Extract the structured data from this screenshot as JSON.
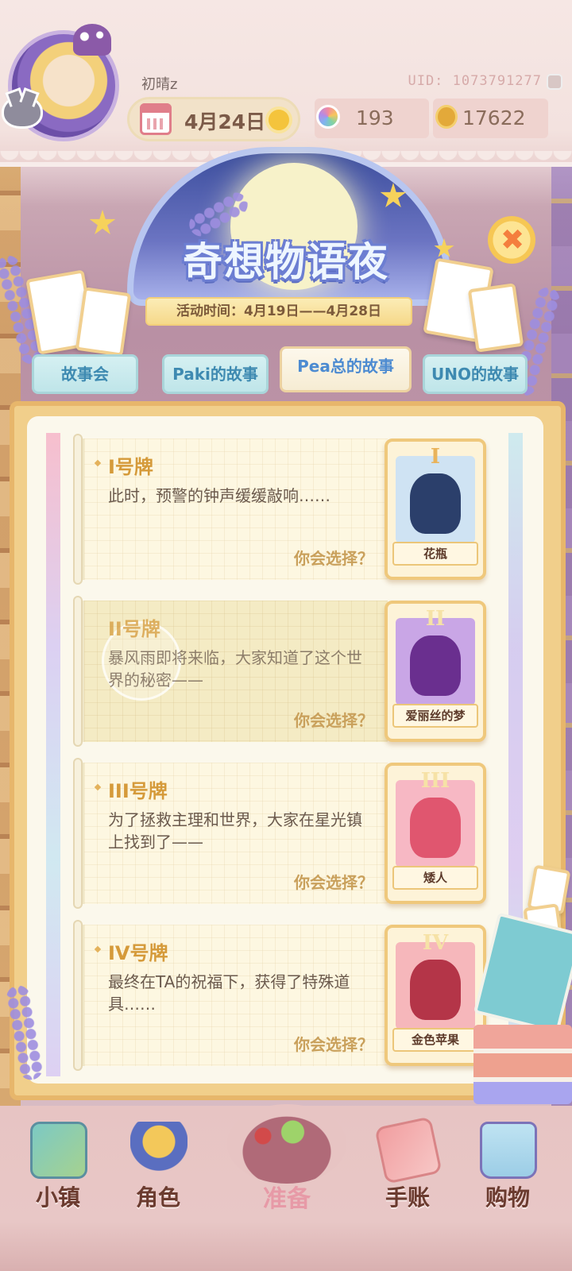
{
  "user": {
    "name": "初晴z",
    "uid": "UID: 1073791277",
    "date": "4月24日",
    "gems": "193",
    "coins": "17622"
  },
  "event": {
    "title": "奇想物语夜",
    "time": "活动时间：4月19日——4月28日"
  },
  "tabs": [
    {
      "label": "故事会",
      "active": false
    },
    {
      "label": "Paki的故事",
      "active": false
    },
    {
      "label": "Pea总的故事",
      "active": true
    },
    {
      "label": "UNO的故事",
      "active": false
    }
  ],
  "entries": [
    {
      "title": "I号牌",
      "text": "此时，预警的钟声缓缓敲响……",
      "choose": "你会选择？",
      "card_numeral": "I",
      "card_label": "花瓶",
      "card_color": "#cfe3f3",
      "art_color": "#2b3f6b"
    },
    {
      "title": "II号牌",
      "text": "暴风雨即将来临，大家知道了这个世界的秘密——",
      "choose": "你会选择？",
      "card_numeral": "II",
      "card_label": "爱丽丝的梦",
      "card_color": "#c9a6e6",
      "art_color": "#6a2f8f"
    },
    {
      "title": "III号牌",
      "text": "为了拯救主理和世界，大家在星光镇上找到了——",
      "choose": "你会选择？",
      "card_numeral": "III",
      "card_label": "矮人",
      "card_color": "#f7b8c4",
      "art_color": "#e0566f"
    },
    {
      "title": "IV号牌",
      "text": "最终在TA的祝福下，获得了特殊道具……",
      "choose": "你会选择？",
      "card_numeral": "IV",
      "card_label": "金色苹果",
      "card_color": "#f6b7bb",
      "art_color": "#b43548"
    }
  ],
  "nav": [
    {
      "label": "小镇",
      "icon": "map-icon"
    },
    {
      "label": "角色",
      "icon": "character-icon"
    },
    {
      "label": "准备",
      "icon": "prepare-icon"
    },
    {
      "label": "手账",
      "icon": "journal-icon"
    },
    {
      "label": "购物",
      "icon": "shopping-bag-icon"
    }
  ],
  "colors": {
    "accent_gold": "#d59a3a",
    "tab_blue": "#3e8ab1",
    "panel_frame": "#e7b66b"
  }
}
